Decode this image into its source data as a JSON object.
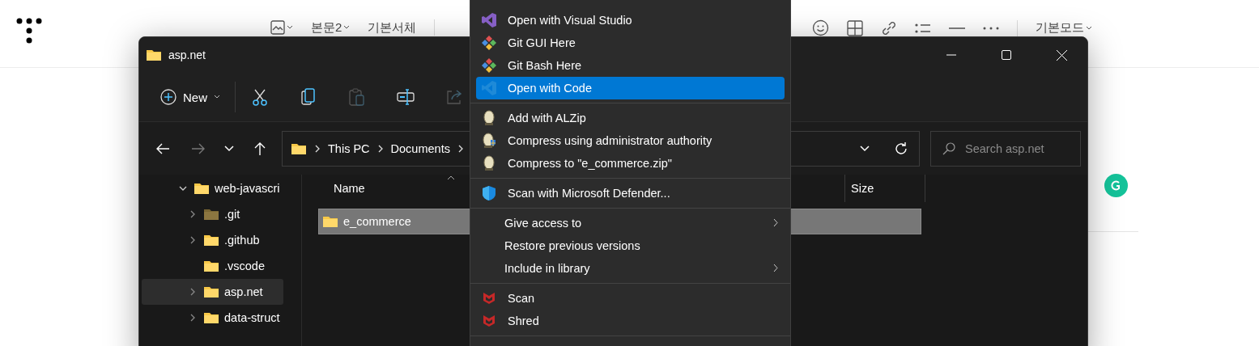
{
  "editor": {
    "toolbar_left": [
      {
        "label": "본문2",
        "dropdown": true
      },
      {
        "label": "기본서체",
        "dropdown": false
      }
    ],
    "toolbar_right": [
      {
        "label": "기본모드",
        "dropdown": true
      }
    ]
  },
  "explorer": {
    "title": "asp.net",
    "new_button": {
      "label": "New"
    },
    "tools": [
      {
        "kind": "cut",
        "disabled": false
      },
      {
        "kind": "copy",
        "disabled": false
      },
      {
        "kind": "paste",
        "disabled": true
      },
      {
        "kind": "rename",
        "disabled": false
      },
      {
        "kind": "share",
        "disabled": true
      }
    ],
    "nav": {
      "back_disabled": false,
      "forward_disabled": true
    },
    "address": [
      "This PC",
      "Documents"
    ],
    "search": {
      "placeholder": "Search asp.net"
    },
    "tree": [
      {
        "label": "web-javascri",
        "expanded": true,
        "has_children": true,
        "selected": false,
        "hidden": false,
        "children": [
          {
            "label": ".git",
            "expanded": false,
            "has_children": true,
            "selected": false,
            "hidden": true
          },
          {
            "label": ".github",
            "expanded": false,
            "has_children": true,
            "selected": false,
            "hidden": false
          },
          {
            "label": ".vscode",
            "has_children": false,
            "selected": false,
            "hidden": false
          },
          {
            "label": "asp.net",
            "expanded": false,
            "has_children": true,
            "selected": true,
            "hidden": false
          },
          {
            "label": "data-struct",
            "expanded": false,
            "has_children": true,
            "selected": false,
            "hidden": false
          }
        ]
      }
    ],
    "columns": [
      {
        "label": "Name",
        "sorted": true
      },
      {
        "label": "Size",
        "sorted": false
      }
    ],
    "rows": [
      {
        "name": "e_commerce",
        "selected": true
      }
    ]
  },
  "context_menu": {
    "groups": [
      [
        {
          "label": "Open with Visual Studio",
          "kind": "visual-studio",
          "selected": false,
          "submenu": false
        },
        {
          "label": "Git GUI Here",
          "kind": "git",
          "selected": false,
          "submenu": false
        },
        {
          "label": "Git Bash Here",
          "kind": "git",
          "selected": false,
          "submenu": false
        },
        {
          "label": "Open with Code",
          "kind": "vscode",
          "selected": true,
          "submenu": false
        }
      ],
      [
        {
          "label": "Add with ALZip",
          "kind": "alzip",
          "selected": false,
          "submenu": false
        },
        {
          "label": "Compress using administrator authority",
          "kind": "alzip-admin",
          "selected": false,
          "submenu": false
        },
        {
          "label": "Compress to \"e_commerce.zip\"",
          "kind": "alzip",
          "selected": false,
          "submenu": false
        }
      ],
      [
        {
          "label": "Scan with Microsoft Defender...",
          "kind": "defender",
          "selected": false,
          "submenu": false
        }
      ],
      [
        {
          "label": "Give access to",
          "kind": "plain",
          "selected": false,
          "submenu": true
        },
        {
          "label": "Restore previous versions",
          "kind": "plain",
          "selected": false,
          "submenu": false
        },
        {
          "label": "Include in library",
          "kind": "plain",
          "selected": false,
          "submenu": true
        }
      ],
      [
        {
          "label": "Scan",
          "kind": "mcafee",
          "selected": false,
          "submenu": false
        },
        {
          "label": "Shred",
          "kind": "mcafee",
          "selected": false,
          "submenu": false
        }
      ]
    ]
  }
}
